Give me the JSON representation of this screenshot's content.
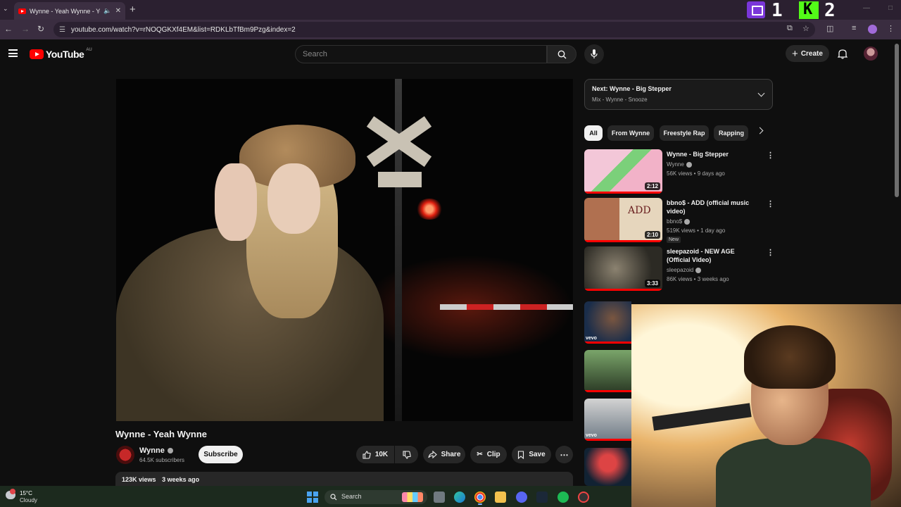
{
  "browser": {
    "tab_title": "Wynne - Yeah Wynne - YouTube",
    "url": "youtube.com/watch?v=rNOQGKXf4EM&list=RDKLbTfBm9Pzg&index=2"
  },
  "overlay": {
    "twitch_count": "1",
    "kick_count": "2",
    "kick_letter": "K"
  },
  "header": {
    "logo_text": "YouTube",
    "region": "AU",
    "search_placeholder": "Search",
    "create_label": "Create"
  },
  "video": {
    "title": "Wynne - Yeah Wynne",
    "channel": "Wynne",
    "subscribers": "64.5K subscribers",
    "subscribe_label": "Subscribe",
    "likes": "10K",
    "share_label": "Share",
    "clip_label": "Clip",
    "save_label": "Save",
    "views": "123K views",
    "age": "3 weeks ago"
  },
  "up_next": {
    "title": "Next: Wynne - Big Stepper",
    "subtitle": "Mix - Wynne - Snooze"
  },
  "chips": [
    "All",
    "From Wynne",
    "Freestyle Rap",
    "Rapping"
  ],
  "recommendations": [
    {
      "title": "Wynne - Big Stepper",
      "channel": "Wynne",
      "meta": "56K views • 9 days ago",
      "duration": "2:12",
      "badge": ""
    },
    {
      "title": "bbno$ - ADD (official music video)",
      "channel": "bbno$",
      "meta": "519K views • 1 day ago",
      "duration": "2:10",
      "badge": "New",
      "thumb_text": "ADD"
    },
    {
      "title": "sleepazoid - NEW AGE (Official Video)",
      "channel": "sleepazoid",
      "meta": "86K views • 3 weeks ago",
      "duration": "3:33",
      "badge": ""
    }
  ],
  "side_thumbs": {
    "vevo_label": "vevo"
  },
  "taskbar": {
    "temperature": "15°C",
    "condition": "Cloudy",
    "search_label": "Search"
  }
}
